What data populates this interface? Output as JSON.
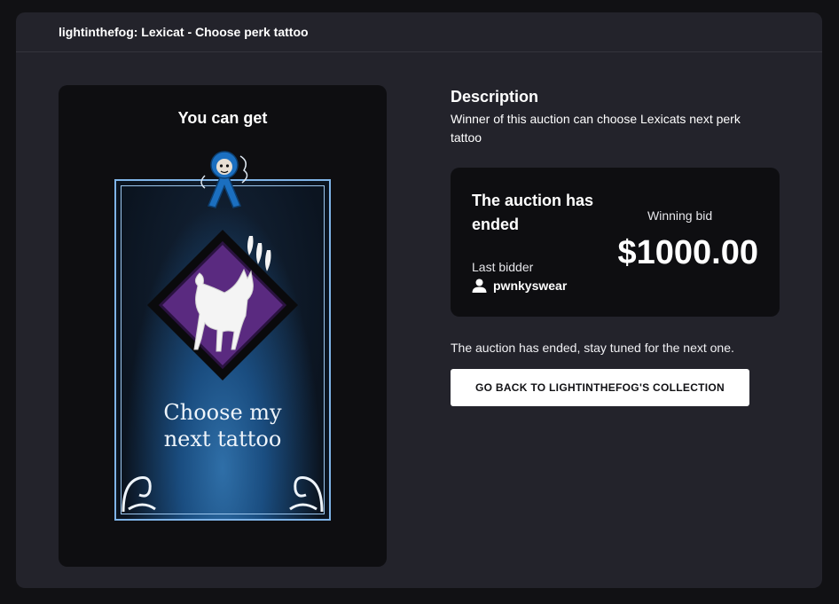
{
  "header": {
    "title": "lightinthefog: Lexicat - Choose perk tattoo"
  },
  "reward": {
    "heading": "You can get",
    "card_caption_line1": "Choose my",
    "card_caption_line2": "next tattoo",
    "colors": {
      "diamond": "#5a2a80",
      "card_border": "#7fb4e8",
      "fog": "#2f6fa8"
    }
  },
  "description": {
    "heading": "Description",
    "text": "Winner of this auction can choose Lexicats next perk tattoo"
  },
  "auction": {
    "status": "The auction has ended",
    "last_bidder_label": "Last bidder",
    "last_bidder_name": "pwnkyswear",
    "winning_label": "Winning bid",
    "winning_amount": "$1000.00"
  },
  "footer": {
    "ended_note": "The auction has ended, stay tuned for the next one.",
    "back_button_label": "GO BACK TO LIGHTINTHEFOG'S COLLECTION"
  }
}
